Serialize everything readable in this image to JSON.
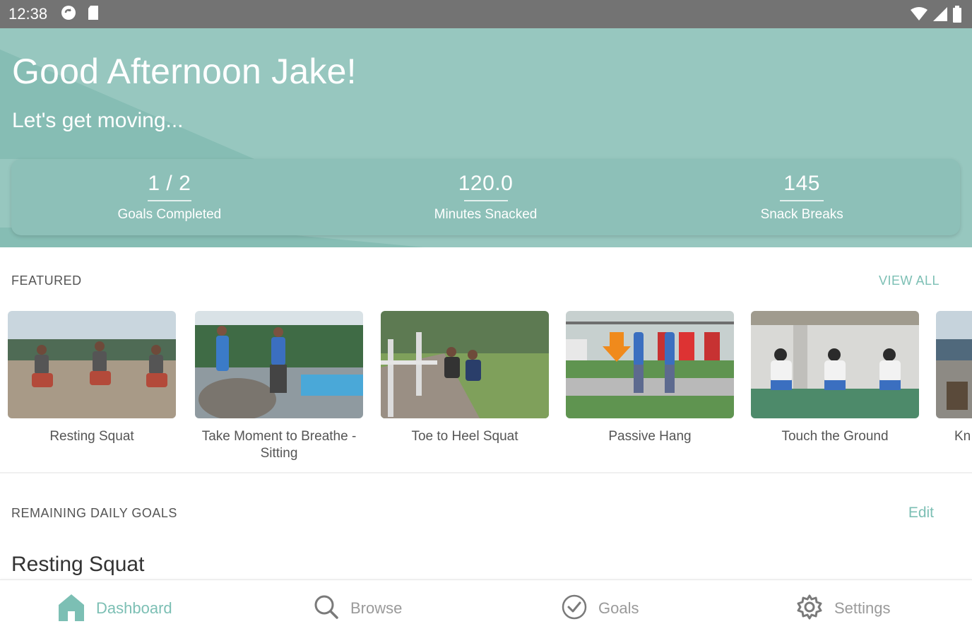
{
  "status_bar": {
    "time": "12:38",
    "left_icons": [
      "sync-icon",
      "sd-card-icon"
    ],
    "right_icons": [
      "wifi-icon",
      "signal-icon",
      "battery-icon"
    ]
  },
  "header": {
    "greeting": "Good Afternoon Jake!",
    "subtitle": "Let's get moving..."
  },
  "stats": [
    {
      "value": "1 / 2",
      "label": "Goals Completed"
    },
    {
      "value": "120.0",
      "label": "Minutes Snacked"
    },
    {
      "value": "145",
      "label": "Snack Breaks"
    }
  ],
  "featured": {
    "title": "FEATURED",
    "view_all": "VIEW ALL",
    "items": [
      {
        "label": "Resting Squat"
      },
      {
        "label": "Take Moment to Breathe - Sitting"
      },
      {
        "label": "Toe to Heel Squat"
      },
      {
        "label": "Passive Hang"
      },
      {
        "label": "Touch the Ground"
      },
      {
        "label": "Kn"
      }
    ]
  },
  "goals": {
    "title": "REMAINING DAILY GOALS",
    "edit": "Edit",
    "items": [
      {
        "label": "Resting Squat"
      }
    ]
  },
  "nav": {
    "items": [
      {
        "label": "Dashboard",
        "icon": "home-icon",
        "active": true
      },
      {
        "label": "Browse",
        "icon": "search-icon",
        "active": false
      },
      {
        "label": "Goals",
        "icon": "check-circle-icon",
        "active": false
      },
      {
        "label": "Settings",
        "icon": "gear-icon",
        "active": false
      }
    ]
  },
  "colors": {
    "accent": "#7cbfb4",
    "header": "#97c7bf",
    "status_bar": "#737373"
  }
}
